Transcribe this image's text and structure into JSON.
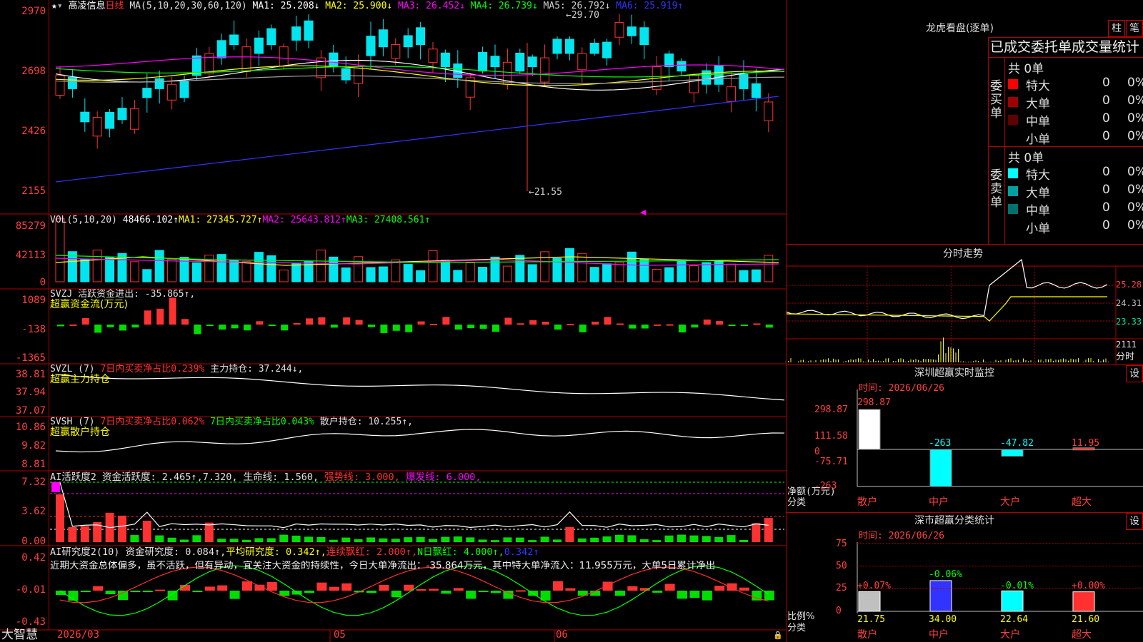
{
  "colors": {
    "up": "#ff3232",
    "down": "#00e5ee",
    "ma1": "#ffffff",
    "ma2": "#ffff00",
    "ma3": "#ff00ff",
    "ma4": "#00ff00",
    "ma5": "#a0a0a0",
    "ma6": "#3333ff",
    "grid": "#b00000"
  },
  "main": {
    "stock_name": "高凌信息",
    "period": "日线",
    "ma_header": "MA(5,10,20,30,60,120)",
    "ma1": "MA1: 25.208↓",
    "ma2": "MA2: 25.900↓",
    "ma3": "MA3: 26.452↓",
    "ma4": "MA4: 26.739↓",
    "ma5": "MA5: 26.792↓",
    "ma6": "MA6: 25.919↑",
    "y_ticks": [
      "2970",
      "2698",
      "2426",
      "2155"
    ],
    "high_marker": "←29.70",
    "low_marker": "←21.55"
  },
  "vol": {
    "title": "VOL(5,10,20)",
    "value": "48466.102↑",
    "ma1": "MA1: 27345.727↑",
    "ma2": "MA2: 25643.812↑",
    "ma3": "MA3: 27408.561↑",
    "y_ticks": [
      "85279",
      "42113",
      "0"
    ]
  },
  "svzj": {
    "title": "SVZJ",
    "desc": "活跃资金进出: -35.865↑,",
    "sub": "超赢资金流(万元)",
    "y_ticks": [
      "1089",
      "-138",
      "-1365"
    ]
  },
  "svzl": {
    "title": "SVZL (7)",
    "p1": "7日内买卖净占比0.239%",
    "p2": "主力持仓: 37.244↓,",
    "sub": "超赢主力持仓",
    "y_ticks": [
      "38.81",
      "37.94",
      "37.07"
    ]
  },
  "svsh": {
    "title": "SVSH (7)",
    "p1": "7日内买卖净占比0.062%",
    "p2": "7日内买卖净占比0.043%",
    "p3": "散户持仓: 10.255↑,",
    "sub": "超赢散户持仓",
    "y_ticks": [
      "10.86",
      "9.82",
      "8.81"
    ]
  },
  "ai1": {
    "title": "AI活跃度2",
    "p1": "资金活跃度: 2.465↑",
    "p2": ",7.320,",
    "p3": "生命线: 1.560,",
    "p4": "强势线: 3.000,",
    "p5": "爆发线: 6.000,",
    "y_ticks": [
      "7.32",
      "3.62",
      "0.00"
    ]
  },
  "ai2": {
    "title": "AI研究度2(10)",
    "p1": "资金研究度: 0.084↑,",
    "p2": "平均研究度: 0.342↑,",
    "p3": "连续飘红: 2.000↑,",
    "p4": "N日飘红: 4.000↑,",
    "p5": "0.342↑",
    "comment": "近期大资金总体偏多，虽不活跃，但有异动，宜关注大资金的持续性，今日大单净流出：-35.864万元，其中特大单净流入：11.955万元，大单5日累计净出",
    "y_ticks": [
      "0.42",
      "-0.01",
      "-0.43"
    ]
  },
  "xaxis": {
    "brand": "大智慧",
    "labels": [
      "2026/03",
      "05",
      "06"
    ]
  },
  "dragon": {
    "title": "龙虎看盘(逐单)",
    "btn_bar": "柱",
    "btn_pen": "笔",
    "subtitle": "已成交委托单成交量统计",
    "buy": {
      "label": "委买单",
      "total": "共 0单",
      "rows": [
        {
          "name": "特大",
          "count": "0",
          "pct": "0%",
          "color": "#ff0000"
        },
        {
          "name": "大单",
          "count": "0",
          "pct": "0%",
          "color": "#a00000"
        },
        {
          "name": "中单",
          "count": "0",
          "pct": "0%",
          "color": "#600000"
        },
        {
          "name": "小单",
          "count": "0",
          "pct": "0%",
          "color": "#000000"
        }
      ]
    },
    "sell": {
      "label": "委卖单",
      "total": "共 0单",
      "rows": [
        {
          "name": "特大",
          "count": "0",
          "pct": "0%",
          "color": "#00ffff"
        },
        {
          "name": "大单",
          "count": "0",
          "pct": "0%",
          "color": "#00a0a0"
        },
        {
          "name": "中单",
          "count": "0",
          "pct": "0%",
          "color": "#007070"
        },
        {
          "name": "小单",
          "count": "0",
          "pct": "0%",
          "color": "#000000"
        }
      ]
    }
  },
  "intraday": {
    "title": "分时走势",
    "y_ticks": [
      "25.28",
      "24.31",
      "23.33"
    ],
    "vol_ticks": [
      "2111",
      "分时"
    ]
  },
  "sz_monitor": {
    "title": "深圳超赢实时监控",
    "btn": "设",
    "time": "时间: 2026/06/26",
    "y_ticks": [
      "298.87",
      "111.58",
      "0",
      "-75.71",
      "-263"
    ],
    "ylabel": "净额(万元)",
    "xlabel": "分类",
    "categories": [
      "散户",
      "中户",
      "大户",
      "超大"
    ],
    "values": [
      298.87,
      -263,
      -47.82,
      11.95
    ],
    "labels": [
      "298.87",
      "-263",
      "-47.82",
      "11.95"
    ]
  },
  "sz_stats": {
    "title": "深市超赢分类统计",
    "btn": "设",
    "time": "时间: 2026/06/26",
    "y_ticks": [
      "75",
      "50",
      "25",
      "0"
    ],
    "ylabel": "比例%",
    "xlabel": "分类",
    "categories": [
      "散户",
      "中户",
      "大户",
      "超大"
    ],
    "values": [
      21.75,
      34.0,
      22.64,
      21.6
    ],
    "values_text": [
      "21.75",
      "34.00",
      "22.64",
      "21.60"
    ],
    "changes": [
      "+0.07%",
      "-0.06%",
      "-0.01%",
      "+0.00%"
    ]
  }
}
